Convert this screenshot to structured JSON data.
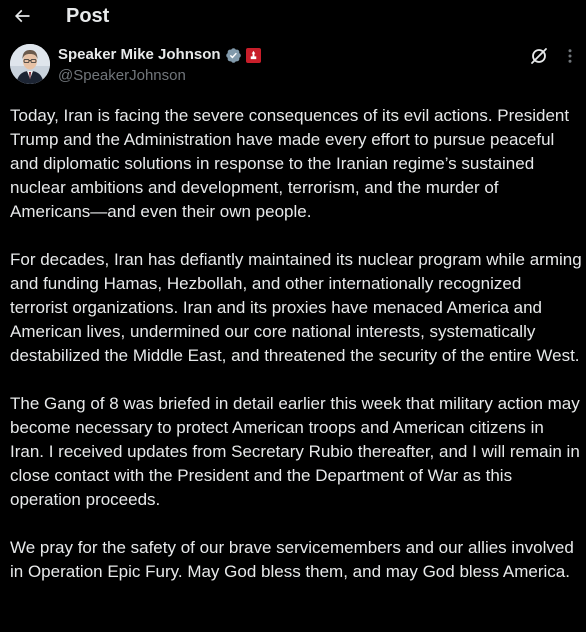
{
  "header": {
    "title": "Post"
  },
  "author": {
    "display_name": "Speaker Mike Johnson",
    "handle": "@SpeakerJohnson",
    "verified_badge_color": "#829aab",
    "affiliation_badge_color": "#c81e2a"
  },
  "post": {
    "paragraphs": [
      "Today, Iran is facing the severe consequences of its evil actions. President Trump and the Administration have made every effort to pursue peaceful and diplomatic solutions in response to the Iranian regime’s sustained nuclear ambitions and development, terrorism, and the murder of Americans—and even their own people.",
      "For decades, Iran has defiantly maintained its nuclear program while arming and funding Hamas, Hezbollah, and other internationally recognized terrorist organizations. Iran and its proxies have menaced America and American lives, undermined our core national interests, systematically destabilized the Middle East, and threatened the security of the entire West.",
      "The Gang of 8 was briefed in detail earlier this week that military action may become necessary to protect American troops and American citizens in Iran. I received updates from Secretary Rubio thereafter, and I will remain in close contact with the President and the Department of War as this operation proceeds.",
      "We pray for the safety of our brave servicemembers and our allies involved in Operation Epic Fury. May God bless them, and may God bless America."
    ]
  },
  "icons": {
    "back": "arrow-left-icon",
    "verified": "verified-badge-icon",
    "affiliation": "affiliation-badge-icon",
    "grok": "grok-icon",
    "more": "more-dots-icon"
  },
  "theme": {
    "background": "#000000",
    "text_primary": "#e7e9ea",
    "text_secondary": "#71767b"
  }
}
